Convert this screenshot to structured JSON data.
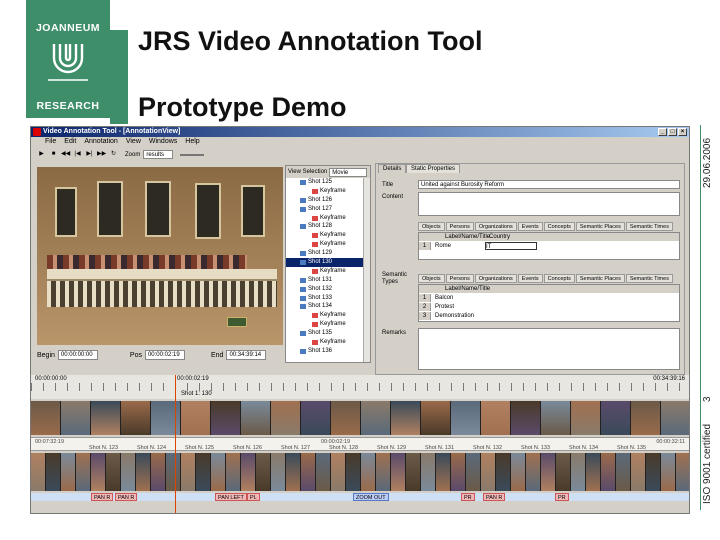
{
  "slide": {
    "title": "JRS Video Annotation Tool",
    "subtitle": "Prototype Demo",
    "logo_top": "JOANNEUM",
    "logo_bottom": "RESEARCH",
    "date": "29.06.2006",
    "page": "3",
    "iso": "ISO 9001 certified",
    "brand_color": "#3f8e6a"
  },
  "app": {
    "window_title": "Video Annotation Tool - [AnnotationView]",
    "menu": [
      "File",
      "Edit",
      "Annotation",
      "View",
      "Windows",
      "Help"
    ],
    "zoom_label": "Zoom",
    "zoom_value": "results",
    "time": {
      "begin_label": "Begin",
      "begin": "00:00:00:00",
      "pos_label": "Pos",
      "pos": "00:00:02:19",
      "end_label": "End",
      "end": "00:34:39:14"
    },
    "tree": {
      "label": "View Selection",
      "selected": "Movie",
      "nodes": [
        {
          "t": "Shot 125",
          "k": 0
        },
        {
          "t": "Keyframe",
          "k": 1
        },
        {
          "t": "Shot 126",
          "k": 0
        },
        {
          "t": "Shot 127",
          "k": 0
        },
        {
          "t": "Keyframe",
          "k": 1
        },
        {
          "t": "Shot 128",
          "k": 0
        },
        {
          "t": "Keyframe",
          "k": 1
        },
        {
          "t": "Keyframe",
          "k": 1
        },
        {
          "t": "Shot 129",
          "k": 0
        },
        {
          "t": "Shot 130",
          "k": 0
        },
        {
          "t": "Keyframe",
          "k": 1
        },
        {
          "t": "Shot 131",
          "k": 0
        },
        {
          "t": "Shot 132",
          "k": 0
        },
        {
          "t": "Shot 133",
          "k": 0
        },
        {
          "t": "Shot 134",
          "k": 0
        },
        {
          "t": "Keyframe",
          "k": 1
        },
        {
          "t": "Keyframe",
          "k": 1
        },
        {
          "t": "Shot 135",
          "k": 0
        },
        {
          "t": "Keyframe",
          "k": 1
        },
        {
          "t": "Shot 136",
          "k": 0
        }
      ]
    },
    "details": {
      "tab_details": "Details",
      "tab_static": "Static Properties",
      "title_label": "Title",
      "title_value": "United against Burosity Reform",
      "content_label": "Content",
      "semantic_label": "Semantic Types",
      "remarks_label": "Remarks",
      "subtabs": [
        "Objects",
        "Persons",
        "Organizations",
        "Events",
        "Concepts",
        "Semantic Places",
        "Semantic Times"
      ],
      "grid1_header": "Label/Name/Title",
      "grid1_header2": "Country",
      "grid1_rows": [
        {
          "n": "1",
          "v": "Rome",
          "c": "IT"
        }
      ],
      "grid2_header": "Label/Name/Title",
      "grid2_rows": [
        {
          "n": "1",
          "v": "Balcon"
        },
        {
          "n": "2",
          "v": "Protest"
        },
        {
          "n": "3",
          "v": "Demonstration"
        }
      ]
    },
    "timeline": {
      "start": "00:00:00:00",
      "cursor": "00:00:02:19",
      "end": "00:34:39:16",
      "shot_label": "Shot 1: 130",
      "shot_start": "00:07:32:19",
      "shot_pos": "00:00:02:19",
      "shot_end": "00:00:32:11",
      "shot_labels": [
        "Shot N. 123",
        "Shot N. 124",
        "Shot N. 125",
        "Shot N. 126",
        "Shot N. 127",
        "Shot N. 128",
        "Shot N. 129",
        "Shot N. 131",
        "Shot N. 132",
        "Shot N. 133",
        "Shot N. 134",
        "Shot N. 135"
      ],
      "camera": [
        {
          "t": "PAN R",
          "c": "r"
        },
        {
          "t": "PAN R",
          "c": "r"
        },
        {
          "t": "PAN LEFT",
          "c": "r"
        },
        {
          "t": "PL",
          "c": "r"
        },
        {
          "t": "ZOOM OUT",
          "c": "b"
        },
        {
          "t": "PR",
          "c": "r"
        },
        {
          "t": "PAN R",
          "c": "r"
        },
        {
          "t": "PR",
          "c": "r"
        }
      ]
    }
  }
}
